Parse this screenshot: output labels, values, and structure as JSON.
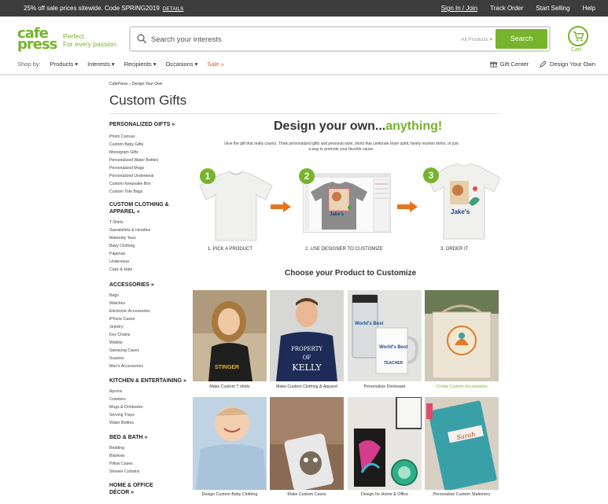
{
  "promo": {
    "message": "25% off sale prices sitewide. Code SPRING2019",
    "details": "DETAILS",
    "links": [
      "Sign In / Join",
      "Track Order",
      "Start Selling",
      "Help"
    ]
  },
  "brand": {
    "logo_line1": "cafe",
    "logo_line2": "press",
    "tagline1": "Perfect.",
    "tagline2": "For every passion.",
    "accent": "#77b32c"
  },
  "search": {
    "placeholder": "Search your interests",
    "category": "All Products",
    "button": "Search"
  },
  "cart": {
    "label": "Cart"
  },
  "shopnav": {
    "label": "Shop by:",
    "items": [
      "Products ▾",
      "Interests ▾",
      "Recipients ▾",
      "Occasions ▾",
      "Sale »"
    ]
  },
  "rightnav": {
    "gift_center": "Gift Center",
    "design_own": "Design Your Own"
  },
  "breadcrumb": {
    "home": "CafePress",
    "sep": "»",
    "current": "Design Your Own"
  },
  "page_title": "Custom Gifts",
  "sidebar": [
    {
      "heading": "PERSONALIZED GIFTS »",
      "items": [
        "Photo Canvas",
        "Custom Baby Gifts",
        "Monogram Gifts",
        "Personalized Water Bottles",
        "Personalized Mugs",
        "Personalized Underwear",
        "Custom Keepsake Box",
        "Custom Tote Bags"
      ]
    },
    {
      "heading": "CUSTOM CLOTHING & APPAREL »",
      "items": [
        "T-Shirts",
        "Sweatshirts & Hoodies",
        "Maternity Tees",
        "Baby Clothing",
        "Pajamas",
        "Underwear",
        "Caps & Hats"
      ]
    },
    {
      "heading": "ACCESSORIES »",
      "items": [
        "Bags",
        "Watches",
        "Electronic Accessories",
        "iPhone Cases",
        "Jewelry",
        "Key Chains",
        "Wallets",
        "Samsung Cases",
        "Scarves",
        "Men's Accessories"
      ]
    },
    {
      "heading": "KITCHEN & ENTERTAINING »",
      "items": [
        "Aprons",
        "Coasters",
        "Mugs & Drinkware",
        "Serving Trays",
        "Water Bottles"
      ]
    },
    {
      "heading": "BED & BATH »",
      "items": [
        "Bedding",
        "Blankets",
        "Pillow Cases",
        "Shower Curtains"
      ]
    },
    {
      "heading": "HOME & OFFICE DÉCOR »",
      "items": []
    }
  ],
  "main": {
    "heading_a": "Design your own...",
    "heading_b": "anything!",
    "intro": "Give the gift that really counts. Think personalized gifts and personal style, shirts that celebrate team spirit, family reunion items, or just a way to promote your favorite cause.",
    "steps": [
      {
        "num": "1",
        "label": "1. PICK A PRODUCT"
      },
      {
        "num": "2",
        "label": "2. USE DESIGNER TO CUSTOMIZE"
      },
      {
        "num": "3",
        "label": "3. ORDER IT"
      }
    ],
    "shirt_text": "Jake's",
    "choose_heading": "Choose your Product to Customize",
    "tiles": [
      {
        "caption": "Make Custom T shirts",
        "shirt_text": "STINGER"
      },
      {
        "caption": "Make Custom Clothing & Apparel",
        "shirt_text1": "PROPERTY",
        "shirt_text2": "OF",
        "shirt_text3": "KELLY"
      },
      {
        "caption": "Personalize Drinkware",
        "mug_text": "World's Best",
        "mug_text2": "TEACHER"
      },
      {
        "caption": "Create Custom Accessories"
      },
      {
        "caption": "Design Custom Baby Clothing"
      },
      {
        "caption": "Make Custom Cases"
      },
      {
        "caption": "Design for Home & Office"
      },
      {
        "caption": "Personalize Custom Stationery",
        "notebook_text": "Sarah"
      }
    ]
  }
}
